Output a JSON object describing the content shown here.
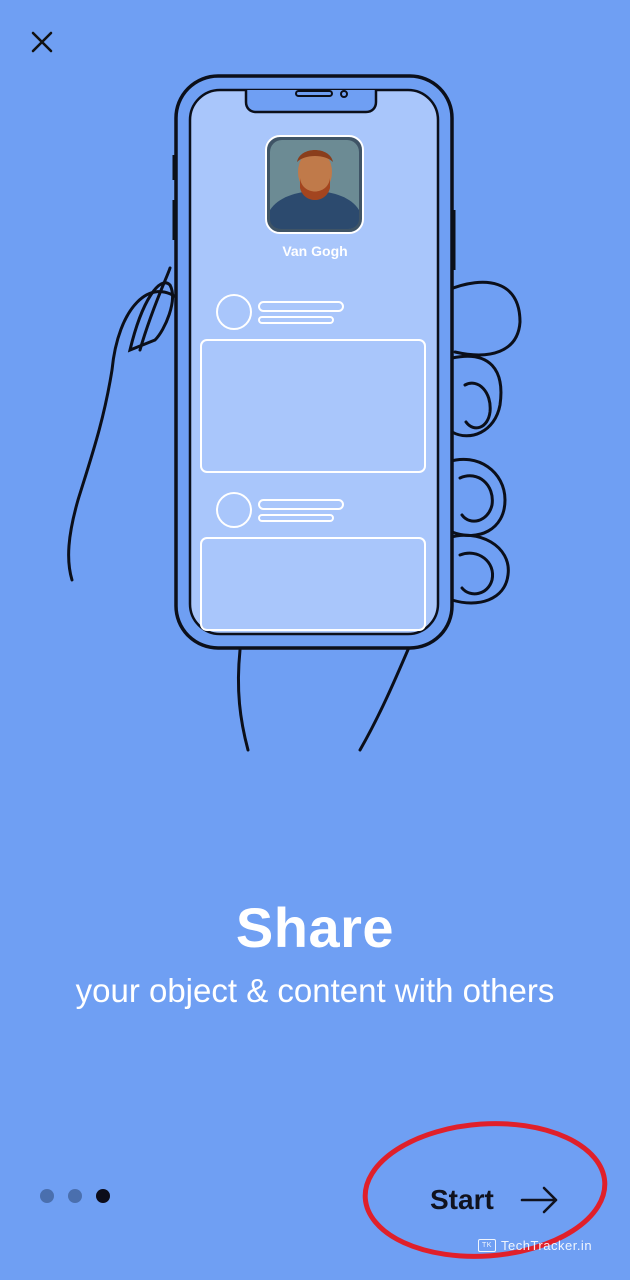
{
  "close_button": {
    "icon": "close-icon"
  },
  "illustration": {
    "profile_name": "Van Gogh",
    "icons": [
      "hand-holding-phone-illustration",
      "profile-avatar"
    ]
  },
  "onboarding": {
    "title": "Share",
    "subtitle": "your object & content with others"
  },
  "pager": {
    "total": 3,
    "active_index": 2
  },
  "start_button": {
    "label": "Start",
    "icon": "arrow-right-icon"
  },
  "watermark": {
    "logo_text": "TK",
    "text": "TechTracker.in"
  },
  "colors": {
    "background": "#6f9ff3",
    "phone_screen": "#a9c6fb",
    "dot_inactive": "#4a6fae",
    "dot_active": "#0c0c1a",
    "annotation_circle": "#e0202a"
  }
}
